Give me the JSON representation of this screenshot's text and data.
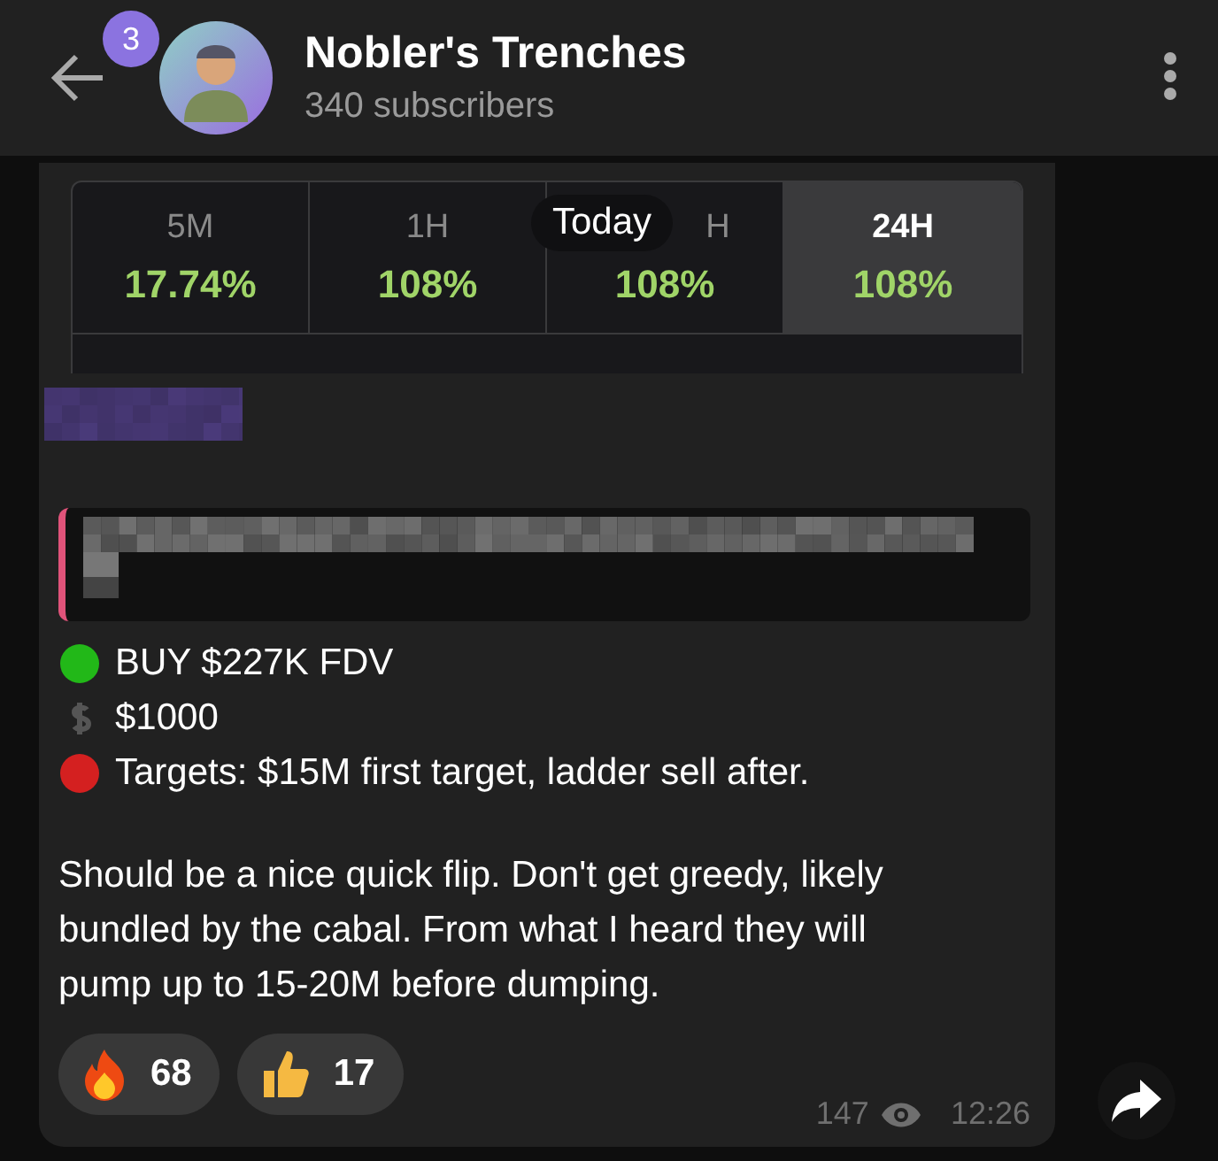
{
  "header": {
    "back_badge": "3",
    "title": "Nobler's Trenches",
    "subtitle": "340 subscribers"
  },
  "date_pill": "Today",
  "stats": [
    {
      "label": "5M",
      "value": "17.74%",
      "selected": false
    },
    {
      "label": "1H",
      "value": "108%",
      "selected": false
    },
    {
      "label": "H",
      "value": "108%",
      "selected": false
    },
    {
      "label": "24H",
      "value": "108%",
      "selected": true
    }
  ],
  "lines": [
    {
      "kind": "green-dot",
      "text": "BUY $227K FDV"
    },
    {
      "kind": "dollar",
      "text": "$1000"
    },
    {
      "kind": "red-dot",
      "text": "Targets: $15M first target, ladder sell after."
    }
  ],
  "paragraph": "Should be a nice quick flip. Don't get greedy, likely bundled by the cabal. From what I heard they will pump up to 15-20M before dumping.",
  "reactions": [
    {
      "kind": "fire",
      "count": "68"
    },
    {
      "kind": "thumbs-up",
      "count": "17"
    }
  ],
  "views": "147",
  "time": "12:26"
}
